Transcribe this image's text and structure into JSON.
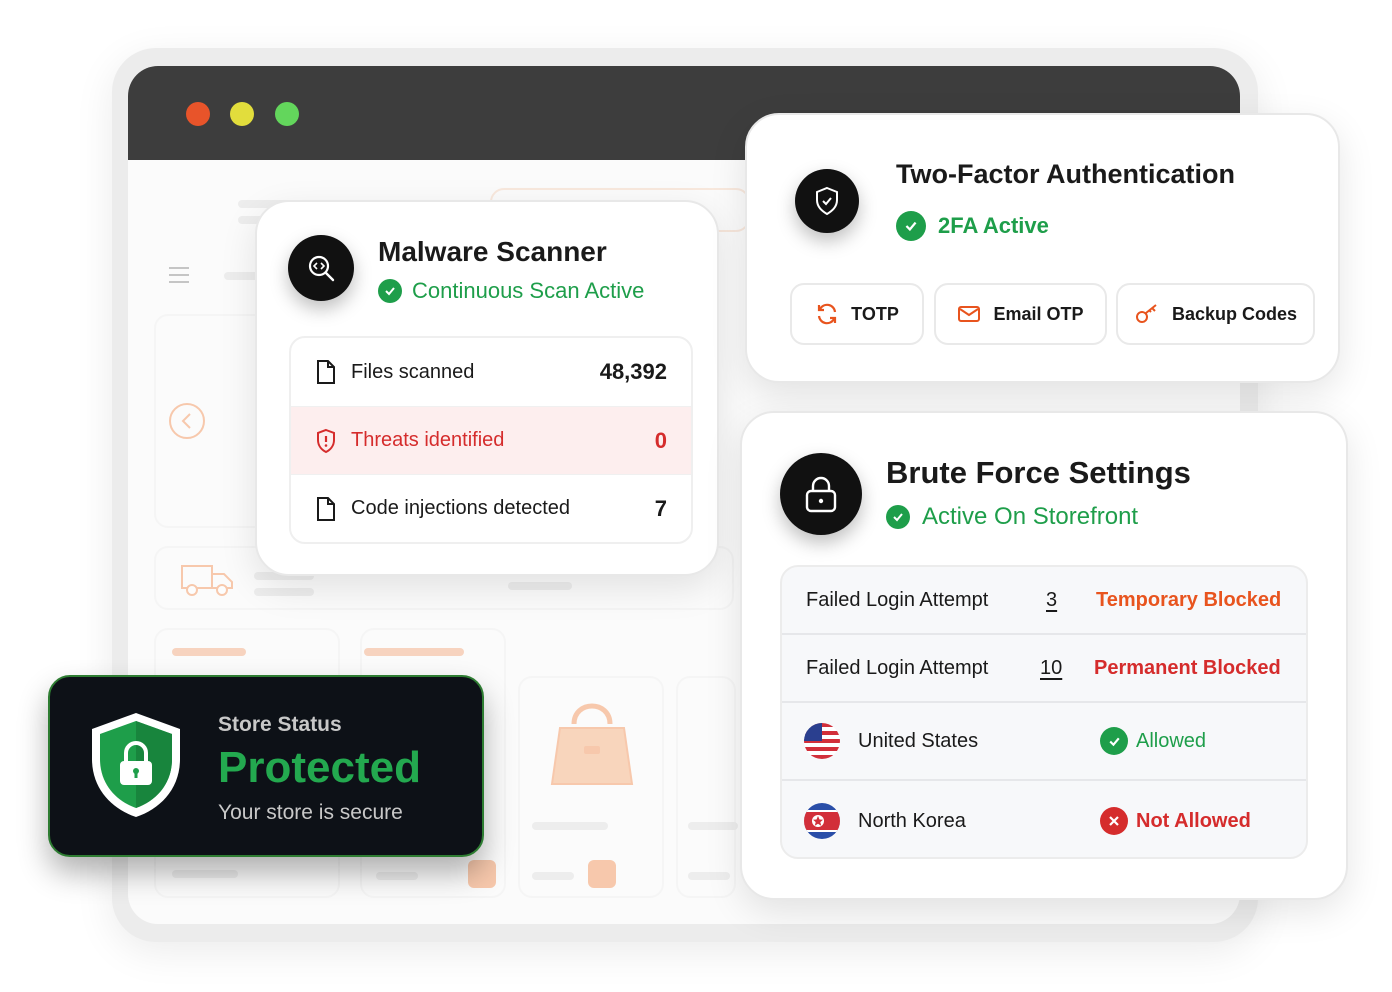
{
  "browser": {
    "window_controls": [
      "close",
      "minimize",
      "maximize"
    ]
  },
  "malware_scanner": {
    "title": "Malware Scanner",
    "status": "Continuous Scan Active",
    "icon": "search-code-icon",
    "rows": [
      {
        "label": "Files scanned",
        "value": "48,392",
        "icon": "file-icon"
      },
      {
        "label": "Threats identified",
        "value": "0",
        "icon": "shield-alert-icon"
      },
      {
        "label": "Code injections detected",
        "value": "7",
        "icon": "file-icon"
      }
    ]
  },
  "two_factor": {
    "title": "Two-Factor Authentication",
    "status": "2FA Active",
    "icon": "shield-check-icon",
    "methods": [
      {
        "label": "TOTP",
        "icon": "refresh-icon"
      },
      {
        "label": "Email OTP",
        "icon": "mail-icon"
      },
      {
        "label": "Backup Codes",
        "icon": "key-icon"
      }
    ]
  },
  "brute_force": {
    "title": "Brute Force Settings",
    "status": "Active On Storefront",
    "icon": "lock-icon",
    "attempts": [
      {
        "label": "Failed Login Attempt",
        "count": "3",
        "result": "Temporary Blocked"
      },
      {
        "label": "Failed Login Attempt",
        "count": "10",
        "result": "Permanent Blocked"
      }
    ],
    "countries": [
      {
        "name": "United States",
        "status": "Allowed",
        "flag": "us-flag-icon"
      },
      {
        "name": "North Korea",
        "status": "Not Allowed",
        "flag": "north-korea-flag-icon"
      }
    ]
  },
  "store_status": {
    "label": "Store Status",
    "state": "Protected",
    "message": "Your store is secure",
    "icon": "shield-lock-icon"
  },
  "colors": {
    "accent_green": "#1e9e4a",
    "danger_red": "#d52c2c",
    "warning_orange": "#e8541e",
    "shop_orange": "#f4a06c",
    "titlebar": "#3d3d3d",
    "dark_card": "#0d1117"
  }
}
